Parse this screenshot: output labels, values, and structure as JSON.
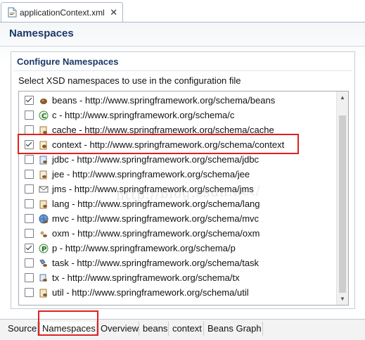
{
  "editor": {
    "tab_label": "applicationContext.xml",
    "tab_icon": "xml-file-icon",
    "close_glyph": "✕"
  },
  "page": {
    "title": "Namespaces"
  },
  "section": {
    "title": "Configure Namespaces",
    "description": "Select XSD namespaces to use in the configuration file"
  },
  "namespaces": [
    {
      "label": "beans - http://www.springframework.org/schema/beans",
      "checked": true,
      "icon": "bean-icon"
    },
    {
      "label": "c - http://www.springframework.org/schema/c",
      "checked": false,
      "icon": "c-namespace-icon"
    },
    {
      "label": "cache - http://www.springframework.org/schema/cache",
      "checked": false,
      "icon": "cache-icon"
    },
    {
      "label": "context - http://www.springframework.org/schema/context",
      "checked": true,
      "icon": "context-icon"
    },
    {
      "label": "jdbc - http://www.springframework.org/schema/jdbc",
      "checked": false,
      "icon": "jdbc-icon"
    },
    {
      "label": "jee - http://www.springframework.org/schema/jee",
      "checked": false,
      "icon": "jee-icon"
    },
    {
      "label": "jms - http://www.springframework.org/schema/jms",
      "checked": false,
      "icon": "jms-icon"
    },
    {
      "label": "lang - http://www.springframework.org/schema/lang",
      "checked": false,
      "icon": "lang-icon"
    },
    {
      "label": "mvc - http://www.springframework.org/schema/mvc",
      "checked": false,
      "icon": "mvc-icon"
    },
    {
      "label": "oxm - http://www.springframework.org/schema/oxm",
      "checked": false,
      "icon": "oxm-icon"
    },
    {
      "label": "p - http://www.springframework.org/schema/p",
      "checked": true,
      "icon": "p-namespace-icon"
    },
    {
      "label": "task - http://www.springframework.org/schema/task",
      "checked": false,
      "icon": "task-icon"
    },
    {
      "label": "tx - http://www.springframework.org/schema/tx",
      "checked": false,
      "icon": "tx-icon"
    },
    {
      "label": "util - http://www.springframework.org/schema/util",
      "checked": false,
      "icon": "util-icon"
    }
  ],
  "watermark": "http://blog.csdn.net/",
  "bottom_tabs": [
    {
      "label": "Source",
      "active": false
    },
    {
      "label": "Namespaces",
      "active": true
    },
    {
      "label": "Overview",
      "active": false
    },
    {
      "label": "beans",
      "active": false
    },
    {
      "label": "context",
      "active": false
    },
    {
      "label": "Beans Graph",
      "active": false
    }
  ],
  "colors": {
    "title": "#1a3968",
    "annotation": "#e02020",
    "tab_border": "#a9b7c9"
  }
}
